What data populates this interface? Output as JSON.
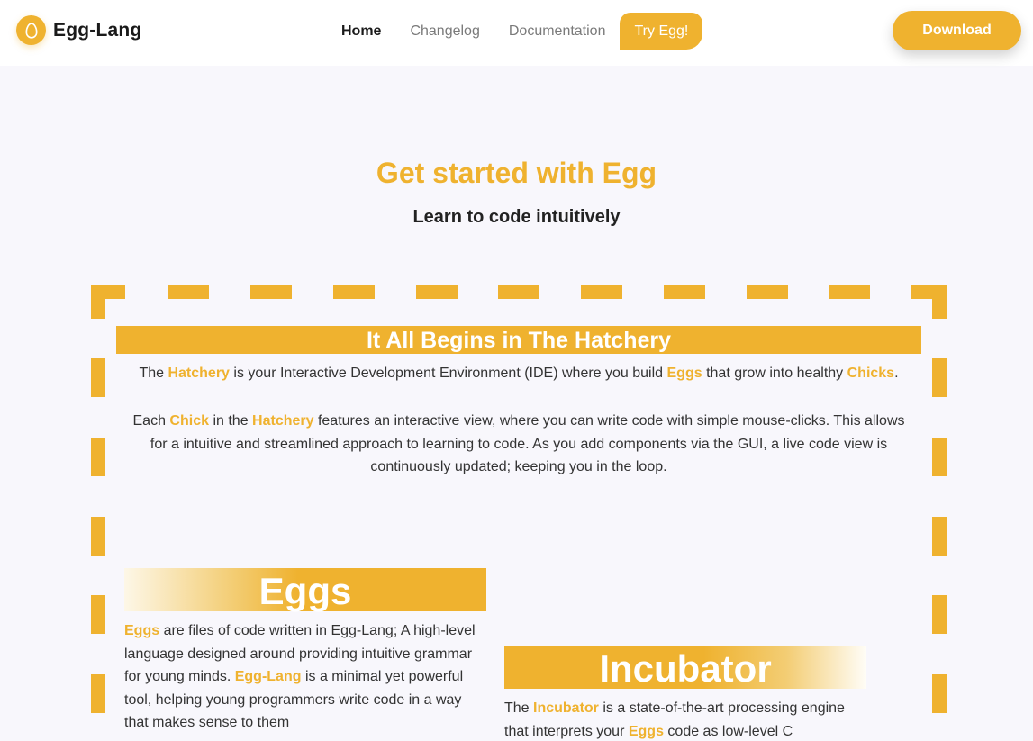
{
  "nav": {
    "brand": "Egg-Lang",
    "links": [
      {
        "label": "Home",
        "active": true
      },
      {
        "label": "Changelog"
      },
      {
        "label": "Documentation"
      },
      {
        "label": "Try Egg!"
      }
    ],
    "download_label": "Download"
  },
  "hero": {
    "title": "Get started with Egg",
    "subtitle": "Learn to code intuitively"
  },
  "hatchery": {
    "banner": "It All Begins in The Hatchery",
    "p1": {
      "t1": "The ",
      "k1": "Hatchery",
      "t2": " is your Interactive Development Environment (IDE) where you build ",
      "k2": "Eggs",
      "t3": " that grow into healthy ",
      "k3": "Chicks",
      "t4": "."
    },
    "p2": {
      "t1": "Each ",
      "k1": "Chick",
      "t2": " in the ",
      "k2": "Hatchery",
      "t3": " features an interactive view, where you can write code with simple mouse-clicks. This allows for a intuitive and streamlined approach to learning to code. As you add components via the GUI, a live code view is continuously updated; keeping you in the loop."
    }
  },
  "eggs": {
    "title": "Eggs",
    "k1": "Eggs",
    "t1": " are files of code written in Egg-Lang; A high-level language designed around providing intuitive grammar for young minds. ",
    "k2": "Egg-Lang",
    "t2": " is a minimal yet powerful tool, helping young programmers write code in a way that makes sense to them"
  },
  "incubator": {
    "title": "Incubator",
    "t1": "The ",
    "k1": "Incubator",
    "t2": " is a state-of-the-art processing engine that interprets your ",
    "k2": "Eggs",
    "t3": " code as low-level C"
  },
  "colors": {
    "accent": "#efb22f",
    "background": "#f8f7fc",
    "text": "#333333"
  },
  "icons": {
    "brand": "egg-icon"
  }
}
